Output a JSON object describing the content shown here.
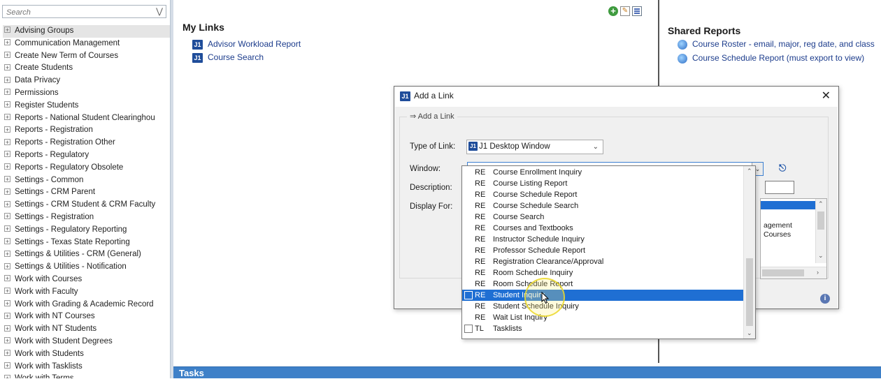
{
  "left_nav": {
    "search_placeholder": "Search",
    "items": [
      "Advising Groups",
      "Communication Management",
      "Create New Term of Courses",
      "Create Students",
      "Data Privacy",
      "Permissions",
      "Register Students",
      "Reports - National Student Clearinghou",
      "Reports - Registration",
      "Reports - Registration Other",
      "Reports - Regulatory",
      "Reports - Regulatory Obsolete",
      "Settings - Common",
      "Settings - CRM Parent",
      "Settings - CRM Student & CRM Faculty",
      "Settings - Registration",
      "Settings - Regulatory Reporting",
      "Settings - Texas State Reporting",
      "Settings & Utilities - CRM (General)",
      "Settings & Utilities - Notification",
      "Work with Courses",
      "Work with Faculty",
      "Work with Grading & Academic Record",
      "Work with NT Courses",
      "Work with NT Students",
      "Work with Student Degrees",
      "Work with Students",
      "Work with Tasklists",
      "Work with Terms..."
    ],
    "selected_index": 0
  },
  "my_links": {
    "title": "My Links",
    "links": [
      "Advisor Workload Report",
      "Course Search"
    ],
    "icon_badge": "J1"
  },
  "shared_reports": {
    "title": "Shared Reports",
    "reports": [
      "Course Roster - email, major, reg date, and class",
      "Course Schedule Report (must export to view)"
    ]
  },
  "tasks_bar": {
    "label": "Tasks"
  },
  "dialog": {
    "title": "Add a Link",
    "group_label": "Add a Link",
    "type_label": "Type of Link:",
    "type_value": "J1 Desktop Window",
    "window_label": "Window:",
    "window_value": "",
    "description_label": "Description:",
    "display_for_label": "Display For:",
    "display_for_fragments": [
      "agement",
      "Courses"
    ]
  },
  "window_dropdown": {
    "items": [
      {
        "code": "RE",
        "name": "Course Enrollment Inquiry"
      },
      {
        "code": "RE",
        "name": "Course Listing Report"
      },
      {
        "code": "RE",
        "name": "Course Schedule Report"
      },
      {
        "code": "RE",
        "name": "Course Schedule Search"
      },
      {
        "code": "RE",
        "name": "Course Search"
      },
      {
        "code": "RE",
        "name": "Courses and Textbooks"
      },
      {
        "code": "RE",
        "name": "Instructor Schedule Inquiry"
      },
      {
        "code": "RE",
        "name": "Professor Schedule Report"
      },
      {
        "code": "RE",
        "name": "Registration Clearance/Approval"
      },
      {
        "code": "RE",
        "name": "Room Schedule Inquiry"
      },
      {
        "code": "RE",
        "name": "Room Schedule Report"
      },
      {
        "code": "RE",
        "name": "Student Inquiry"
      },
      {
        "code": "RE",
        "name": "Student Schedule Inquiry"
      },
      {
        "code": "RE",
        "name": "Wait List Inquiry"
      },
      {
        "code": "TL",
        "name": "Tasklists"
      }
    ],
    "selected_index": 11
  },
  "icons": {
    "add": "add-circle-icon",
    "edit": "edit-page-icon",
    "grid": "grid-view-icon",
    "search": "binoculars-icon",
    "info": "info-icon"
  },
  "colors": {
    "accent": "#1f6fd3",
    "tasks_bar": "#3e80c8",
    "link": "#1c3c8c"
  }
}
